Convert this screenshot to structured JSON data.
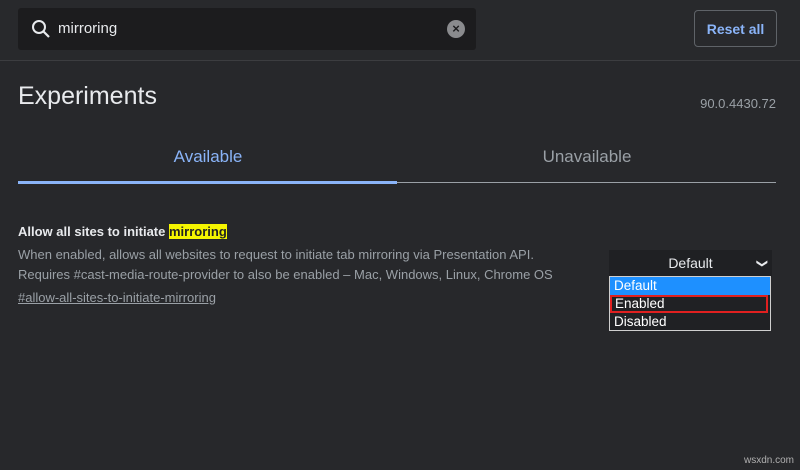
{
  "search": {
    "value": "mirroring",
    "icon": "search-icon",
    "clear_icon": "clear-icon"
  },
  "header": {
    "reset_label": "Reset all"
  },
  "page": {
    "title": "Experiments",
    "version": "90.0.4430.72"
  },
  "tabs": [
    {
      "label": "Available",
      "active": true
    },
    {
      "label": "Unavailable",
      "active": false
    }
  ],
  "experiment": {
    "title_prefix": "Allow all sites to initiate ",
    "title_highlight": "mirroring",
    "desc_line1": "When enabled, allows all websites to request to initiate tab mirroring via Presentation API.",
    "desc_line2": "Requires #cast-media-route-provider to also be enabled – Mac, Windows, Linux, Chrome OS",
    "link": "#allow-all-sites-to-initiate-mirroring",
    "select_value": "Default",
    "options": [
      "Default",
      "Enabled",
      "Disabled"
    ]
  },
  "watermark": "wsxdn.com"
}
